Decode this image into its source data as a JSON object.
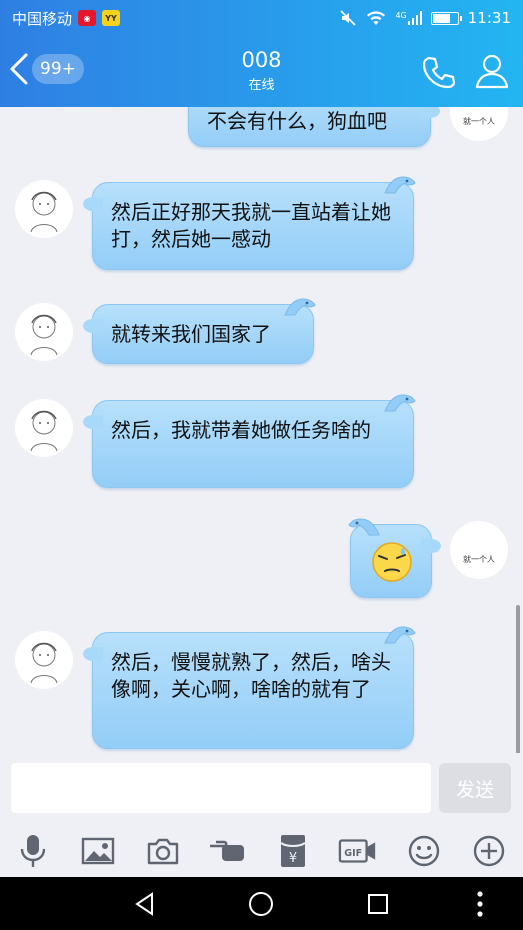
{
  "status_bar": {
    "carrier": "中国移动",
    "weibo_icon": "weibo-icon",
    "yy_icon": "YY",
    "network": "4G",
    "time": "11:31",
    "battery_level": 0.75
  },
  "header": {
    "unread_badge": "99+",
    "title": "008",
    "subtitle": "在线"
  },
  "messages": [
    {
      "side": "right",
      "text": "不会有什么，狗血吧"
    },
    {
      "side": "left",
      "text": "然后正好那天我就一直站着让她打，然后她一感动"
    },
    {
      "side": "left",
      "text": "就转来我们国家了"
    },
    {
      "side": "left",
      "text": "然后，我就带着她做任务啥的"
    },
    {
      "side": "right",
      "text": "",
      "emoji": "sweat-smile-emoji"
    },
    {
      "side": "left",
      "text": "然后，慢慢就熟了，然后，啥头像啊，关心啊，啥啥的就有了"
    }
  ],
  "avatars": {
    "self_caption": "就一个人",
    "friend_caption": "sketch-boy-avatar"
  },
  "input": {
    "value": "",
    "placeholder": "",
    "send_label": "发送"
  },
  "toolbar": [
    "microphone-icon",
    "image-icon",
    "camera-icon",
    "poke-icon",
    "red-packet-icon",
    "gif-icon",
    "emoji-icon",
    "plus-icon"
  ],
  "toolbar_gif_label": "GIF",
  "toolbar_yuan_label": "¥",
  "colors": {
    "header_start": "#2f7fe3",
    "header_end": "#23b5f2",
    "bubble": "#a9d9fa"
  }
}
